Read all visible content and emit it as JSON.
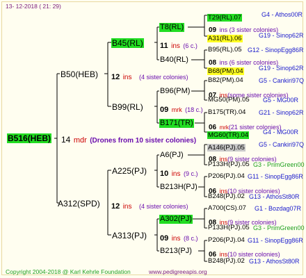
{
  "header": {
    "date": "13-  12-2018  (  21:  29)"
  },
  "footer": {
    "copyright": "Copyright 2004-2018 @ Karl Kehrle Foundation",
    "site": "www.pedigreeapis.org"
  },
  "colors": {
    "highlight_green": "#22dd22",
    "highlight_yellow": "#ffff22",
    "highlight_gray": "#c8c8c8",
    "ins_red": "#cc0000",
    "note_purple": "#6a0dad",
    "info_blue": "#1a1acc"
  },
  "root": {
    "name": "B516(HEB)",
    "num": "14",
    "ins": "mdr",
    "note": "(Drones from 10 sister colonies)"
  },
  "gen1": [
    {
      "name": "B50(HEB)",
      "num": "12",
      "ins": "ins",
      "note": "(4 sister colonies)"
    },
    {
      "name": "A312(SPD)",
      "num": "12",
      "ins": "ins",
      "note": "(4 sister colonies)"
    }
  ],
  "gen2": [
    {
      "name": "B45(RL)",
      "num": "11",
      "ins": "ins",
      "note": "(6 c.)"
    },
    {
      "name": "B99(RL)",
      "num": "09",
      "ins": "mrk",
      "note": "(18 c.)"
    },
    {
      "name": "A225(PJ)",
      "num": "10",
      "ins": "ins",
      "note": "(9 c.)"
    },
    {
      "name": "A313(PJ)",
      "num": "09",
      "ins": "ins",
      "note": "(8 c.)"
    }
  ],
  "gen3": [
    {
      "name": "T8(RL)",
      "num": "",
      "ins": "",
      "note": ""
    },
    {
      "name": "B40(RL)",
      "num": "",
      "ins": "",
      "note": ""
    },
    {
      "name": "B96(PM)",
      "num": "07",
      "ins": "ins",
      "note": "(some sister colonies)"
    },
    {
      "name": "B171(TR)",
      "num": "06",
      "ins": "mrk",
      "note": "(21 sister colonies)"
    },
    {
      "name": "A6(PJ)",
      "num": "08",
      "ins": "ins",
      "note": "(9 sister colonies)"
    },
    {
      "name": "B213H(PJ)",
      "num": "06",
      "ins": "ins",
      "note": "(10 sister colonies)"
    },
    {
      "name": "A302(PJ)",
      "num": "08",
      "ins": "ins",
      "note": "(9 sister colonies)"
    },
    {
      "name": "B213(PJ)",
      "num": "06",
      "ins": "ins",
      "note": "(10 sister colonies)"
    }
  ],
  "gen4": [
    {
      "name": "T29(RL).07",
      "info": "G4 - Athos00R"
    },
    {
      "name": "09",
      "info": "ins (3 sister colonies)"
    },
    {
      "name": "A31(RL).06",
      "info": "G19 - Sinop62R"
    },
    {
      "name": "B95(RL).05",
      "info": "G12 - SinopEgg86R"
    },
    {
      "name": "08",
      "info": "ins (6 sister colonies)"
    },
    {
      "name": "B68(PM).04",
      "info": "G19 - Sinop62R"
    },
    {
      "name": "B82(PM).04",
      "info": "G5 - Cankiri97Q"
    },
    {
      "name": "MG50(PM).05",
      "info": "G5 - MG00R"
    },
    {
      "name": "B175(TR).04",
      "info": "G21 - Sinop62R"
    },
    {
      "name": "MG60(TR).04",
      "info": "G4 - MG00R"
    },
    {
      "name": "A146(PJ).05",
      "info": "G5 - Cankiri97Q"
    },
    {
      "name": "P133H(PJ).05",
      "info": "G3 - PrimGreen00"
    },
    {
      "name": "P206(PJ).04",
      "info": "G11 - SinopEgg86R"
    },
    {
      "name": "B248(PJ).02",
      "info": "G13 - AthosSt80R"
    },
    {
      "name": "A700(CS).07",
      "info": "G1 - Bozdag07R"
    },
    {
      "name": "P133H(PJ).05",
      "info": "G3 - PrimGreen00"
    },
    {
      "name": "P206(PJ).04",
      "info": "G11 - SinopEgg86R"
    },
    {
      "name": "B248(PJ).02",
      "info": "G13 - AthosSt80R"
    }
  ]
}
